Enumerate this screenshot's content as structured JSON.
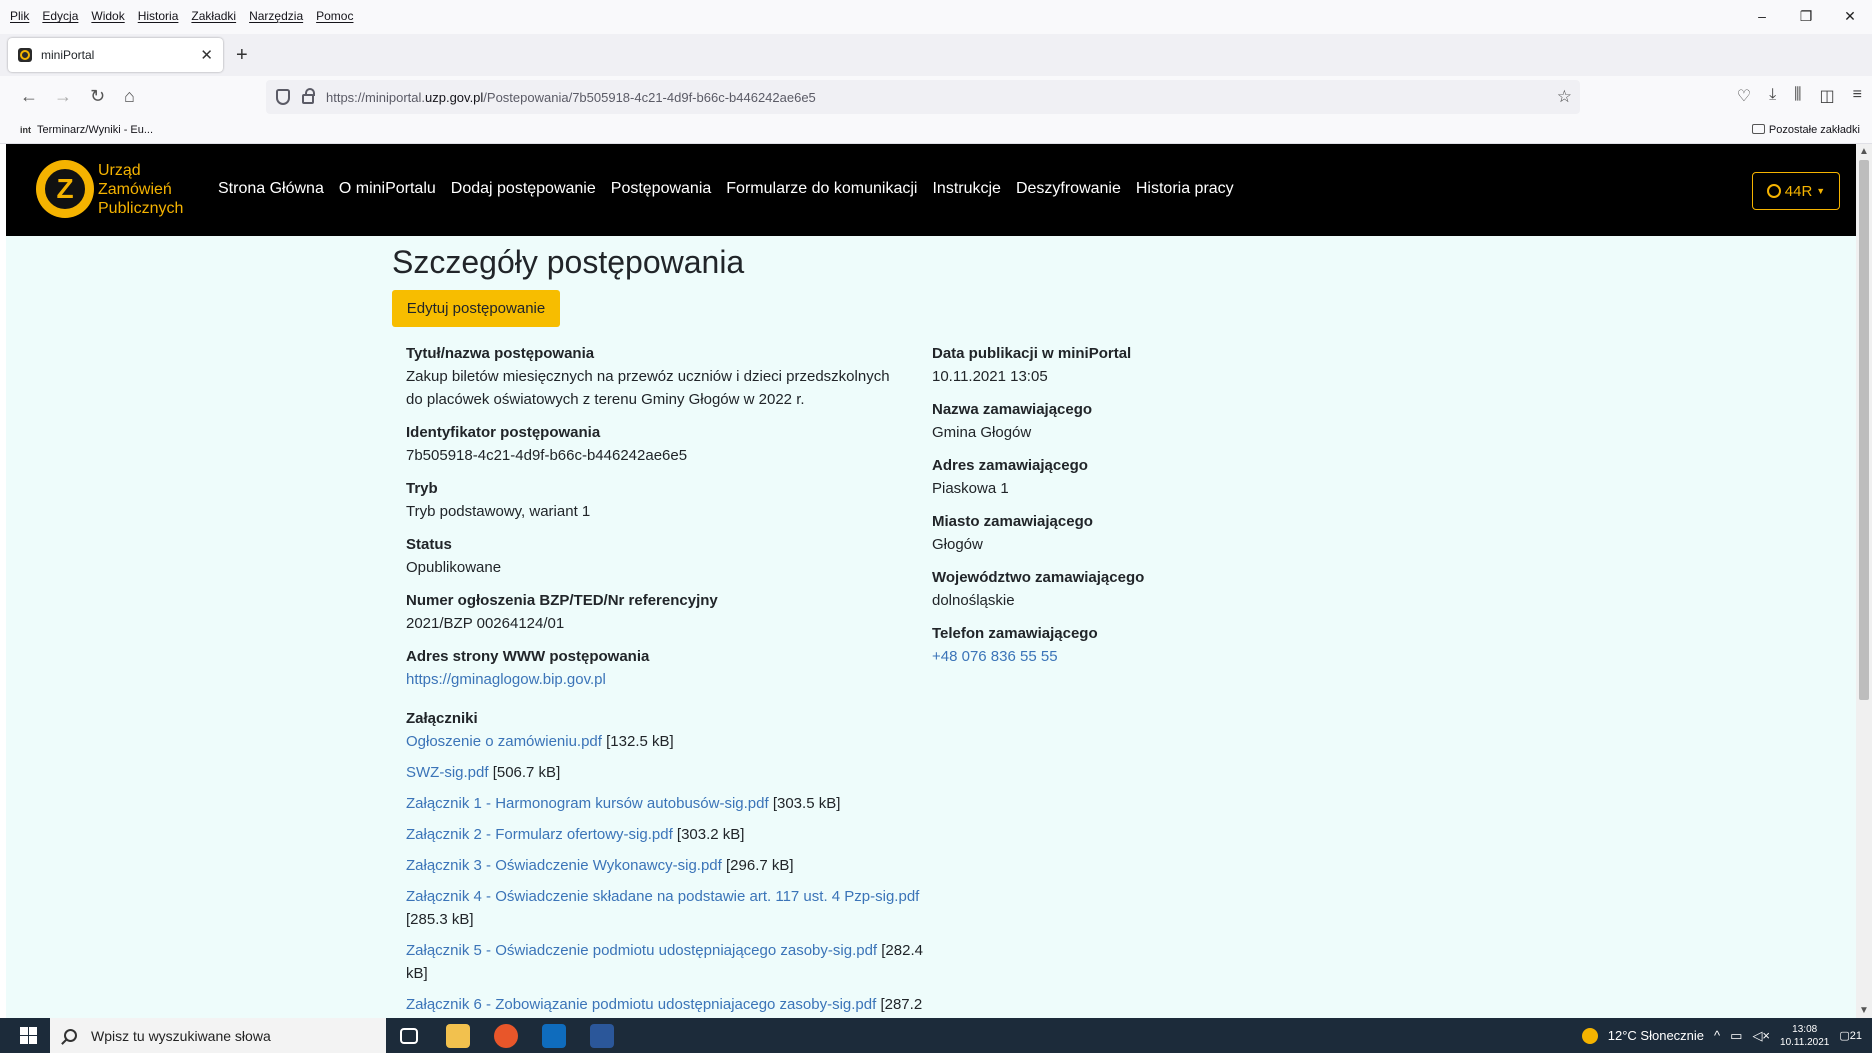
{
  "menubar": {
    "items": [
      "Plik",
      "Edycja",
      "Widok",
      "Historia",
      "Zakładki",
      "Narzędzia",
      "Pomoc"
    ]
  },
  "window_controls": {
    "minimize": "–",
    "restore": "❐",
    "close": "✕"
  },
  "tab": {
    "title": "miniPortal",
    "close": "✕",
    "new_tab": "+"
  },
  "nav": {
    "url_prefix": "https://miniportal.",
    "url_domain": "uzp.gov.pl",
    "url_path": "/Postepowania/7b505918-4c21-4d9f-b66c-b446242ae6e5"
  },
  "bookmarks": {
    "item1_icon": "int",
    "item1": "Terminarz/Wyniki - Eu...",
    "other": "Pozostałe zakładki"
  },
  "site": {
    "logo_letter": "Z",
    "logo_line1": "Urząd",
    "logo_line2": "Zamówień",
    "logo_line3": "Publicznych",
    "nav": [
      "Strona Główna",
      "O miniPortalu",
      "Dodaj postępowanie",
      "Postępowania",
      "Formularze do komunikacji",
      "Instrukcje",
      "Deszyfrowanie",
      "Historia pracy"
    ],
    "user": "44R"
  },
  "page": {
    "title": "Szczegóły postępowania",
    "edit_button": "Edytuj postępowanie",
    "left": [
      {
        "label": "Tytuł/nazwa postępowania",
        "value": "Zakup biletów miesięcznych na przewóz uczniów i dzieci przedszkolnych do placówek oświatowych z terenu Gminy Głogów w 2022 r."
      },
      {
        "label": "Identyfikator postępowania",
        "value": "7b505918-4c21-4d9f-b66c-b446242ae6e5"
      },
      {
        "label": "Tryb",
        "value": "Tryb podstawowy, wariant 1"
      },
      {
        "label": "Status",
        "value": "Opublikowane"
      },
      {
        "label": "Numer ogłoszenia BZP/TED/Nr referencyjny",
        "value": "2021/BZP 00264124/01"
      },
      {
        "label": "Adres strony WWW postępowania",
        "value": "https://gminaglogow.bip.gov.pl"
      }
    ],
    "right": [
      {
        "label": "Data publikacji w miniPortal",
        "value": "10.11.2021 13:05"
      },
      {
        "label": "Nazwa zamawiającego",
        "value": "Gmina Głogów"
      },
      {
        "label": "Adres zamawiającego",
        "value": "Piaskowa 1"
      },
      {
        "label": "Miasto zamawiającego",
        "value": "Głogów"
      },
      {
        "label": "Województwo zamawiającego",
        "value": "dolnośląskie"
      },
      {
        "label": "Telefon zamawiającego",
        "value": "+48 076 836 55 55"
      }
    ],
    "attachments_label": "Załączniki",
    "attachments": [
      {
        "name": "Ogłoszenie o zamówieniu.pdf",
        "size": "[132.5 kB]"
      },
      {
        "name": "SWZ-sig.pdf",
        "size": "[506.7 kB]"
      },
      {
        "name": "Załącznik 1 - Harmonogram kursów autobusów-sig.pdf",
        "size": "[303.5 kB]"
      },
      {
        "name": "Załącznik 2 - Formularz ofertowy-sig.pdf",
        "size": "[303.2 kB]"
      },
      {
        "name": "Załącznik 3 - Oświadczenie Wykonawcy-sig.pdf",
        "size": "[296.7 kB]"
      },
      {
        "name": "Załącznik 4 - Oświadczenie składane na podstawie art. 117 ust. 4 Pzp-sig.pdf",
        "size": "[285.3 kB]"
      },
      {
        "name": "Załącznik 5 - Oświadczenie podmiotu udostępniającego zasoby-sig.pdf",
        "size": "[282.4 kB]"
      },
      {
        "name": "Załącznik 6 - Zobowiązanie podmiotu udostępniajacego zasoby-sig.pdf",
        "size": "[287.2"
      }
    ]
  },
  "taskbar": {
    "search_placeholder": "Wpisz tu wyszukiwane słowa",
    "weather": "12°C  Słonecznie",
    "time": "13:08",
    "date": "10.11.2021",
    "notifications": "21"
  }
}
